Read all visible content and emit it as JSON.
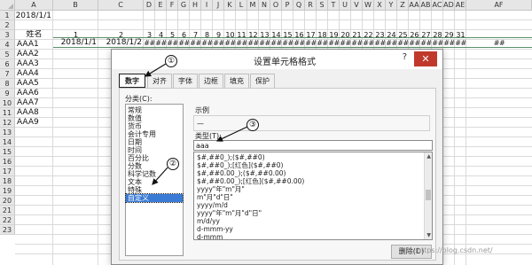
{
  "spreadsheet": {
    "column_headers": [
      "A",
      "B",
      "C",
      "D",
      "E",
      "F",
      "G",
      "H",
      "I",
      "J",
      "K",
      "L",
      "M",
      "N",
      "O",
      "P",
      "Q",
      "R",
      "S",
      "T",
      "U",
      "V",
      "W",
      "X",
      "Y",
      "Z",
      "AA",
      "AB",
      "AC",
      "AD",
      "AE",
      "AF"
    ],
    "row_numbers": [
      "1",
      "2",
      "3",
      "4",
      "5",
      "6",
      "7",
      "8",
      "9",
      "10",
      "11",
      "12",
      "13",
      "14",
      "15",
      "16",
      "17",
      "18",
      "19",
      "20",
      "21",
      "22",
      "23"
    ],
    "a1": "2018/1/1",
    "a2_3": "姓名",
    "row2_numbers": [
      "1",
      "2",
      "3",
      "4",
      "5",
      "6",
      "7",
      "8",
      "9",
      "10",
      "11",
      "12",
      "13",
      "14",
      "15",
      "16",
      "17",
      "18",
      "19",
      "20",
      "21",
      "22",
      "23",
      "24",
      "25",
      "26",
      "27",
      "28",
      "29",
      "31"
    ],
    "b3": "2018/1/1",
    "c3": "2018/1/2",
    "hash": "##",
    "names": [
      "AAA1",
      "AAA2",
      "AAA3",
      "AAA4",
      "AAA5",
      "AAA6",
      "AAA7",
      "AAA8",
      "AAA9"
    ]
  },
  "dialog": {
    "title": "设置单元格格式",
    "help": "?",
    "close": "✕",
    "tabs": [
      "数字",
      "对齐",
      "字体",
      "边框",
      "填充",
      "保护"
    ],
    "category_label": "分类(C):",
    "categories": [
      "常规",
      "数值",
      "货币",
      "会计专用",
      "日期",
      "时间",
      "百分比",
      "分数",
      "科学记数",
      "文本",
      "特殊",
      "自定义"
    ],
    "selected_category": "自定义",
    "sample_label": "示例",
    "sample_value": "—",
    "type_label": "类型(T):",
    "type_value": "aaa",
    "format_list": [
      "$#,##0_);($#,##0)",
      "$#,##0_);[红色]($#,##0)",
      "$#,##0.00_);($#,##0.00)",
      "$#,##0.00_);[红色]($#,##0.00)",
      "yyyy\"年\"m\"月\"",
      "m\"月\"d\"日\"",
      "yyyy/m/d",
      "yyyy\"年\"m\"月\"d\"日\"",
      "m/d/yy",
      "d-mmm-yy",
      "d-mmm"
    ],
    "delete_button": "删除(D)"
  },
  "annotations": [
    "①",
    "②",
    "③"
  ],
  "watermark": "https://blog.csdn.net/",
  "colors": {
    "accent": "#3a7bd5",
    "close": "#c0392b",
    "frozen_border": "#5c8f6a"
  }
}
